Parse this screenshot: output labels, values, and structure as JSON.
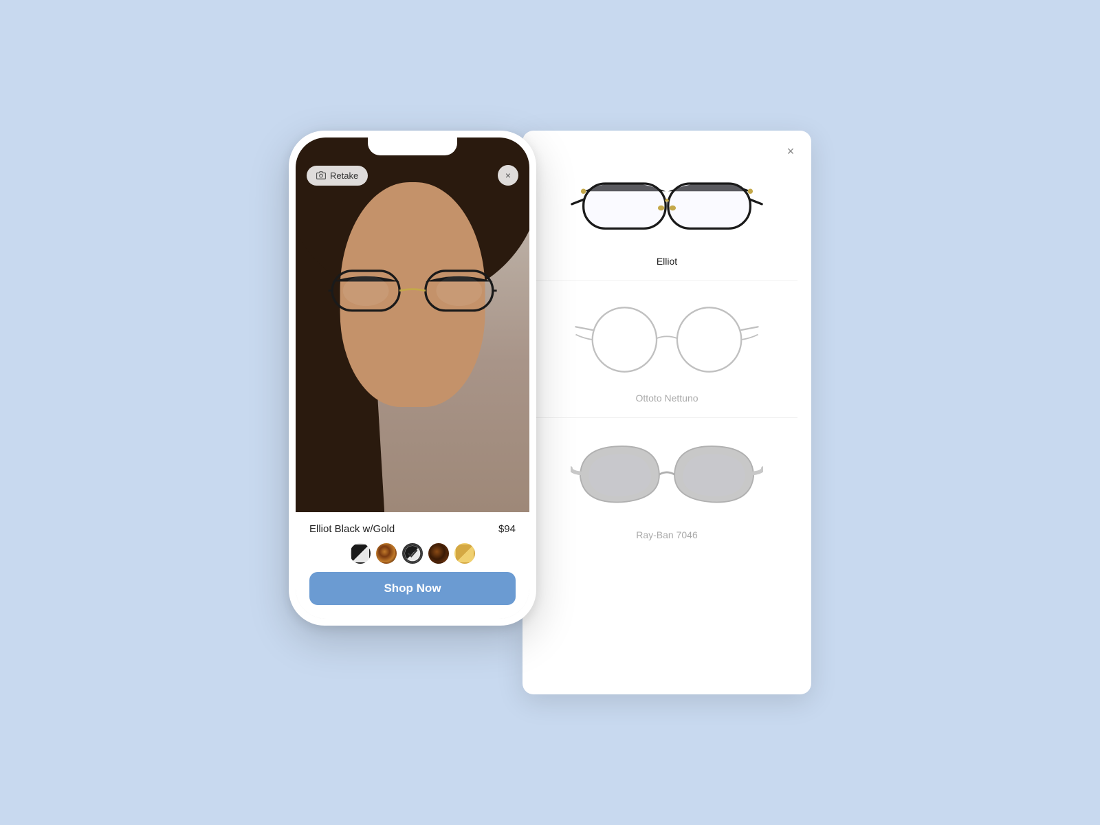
{
  "background_color": "#c8d9ef",
  "phone": {
    "retake_label": "Retake",
    "close_label": "×",
    "product_name": "Elliot Black w/Gold",
    "product_price": "$94",
    "shop_now_label": "Shop Now",
    "swatches": [
      {
        "id": "bw",
        "label": "Black/White",
        "selected": false
      },
      {
        "id": "tortoise",
        "label": "Tortoise",
        "selected": false
      },
      {
        "id": "check",
        "label": "Black Check",
        "selected": true
      },
      {
        "id": "dark-tort",
        "label": "Dark Tortoise",
        "selected": false
      },
      {
        "id": "gold",
        "label": "Gold",
        "selected": false
      }
    ]
  },
  "panel": {
    "close_label": "×",
    "items": [
      {
        "id": "elliot",
        "label": "Elliot",
        "style": "browline",
        "muted": false
      },
      {
        "id": "ottoto",
        "label": "Ottoto Nettuno",
        "style": "round-silver",
        "muted": true
      },
      {
        "id": "rayban",
        "label": "Ray-Ban 7046",
        "style": "round-gray",
        "muted": true
      }
    ]
  }
}
